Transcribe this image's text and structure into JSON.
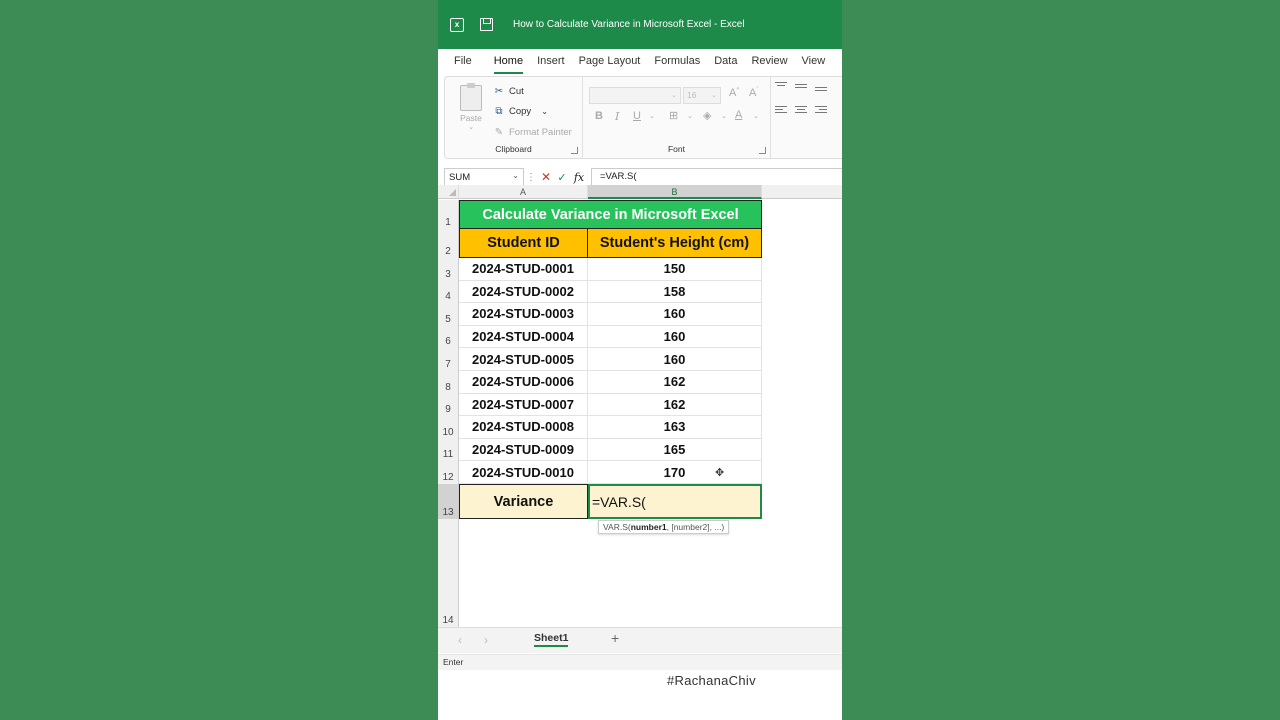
{
  "window": {
    "title": "How to Calculate Variance in Microsoft Excel  -  Excel"
  },
  "menu_tabs": [
    "File",
    "Home",
    "Insert",
    "Page Layout",
    "Formulas",
    "Data",
    "Review",
    "View"
  ],
  "ribbon": {
    "clipboard": {
      "paste": "Paste",
      "cut": "Cut",
      "copy": "Copy",
      "format_painter": "Format Painter",
      "label": "Clipboard"
    },
    "font": {
      "size": "16",
      "label": "Font"
    }
  },
  "formula_bar": {
    "name_box": "SUM",
    "formula": "=VAR.S("
  },
  "columns": [
    "A",
    "B"
  ],
  "rows": [
    "1",
    "2",
    "3",
    "4",
    "5",
    "6",
    "7",
    "8",
    "9",
    "10",
    "11",
    "12",
    "13",
    "14"
  ],
  "sheet": {
    "title": "Calculate Variance in Microsoft Excel",
    "headers": [
      "Student ID",
      "Student's Height (cm)"
    ],
    "data": [
      [
        "2024-STUD-0001",
        "150"
      ],
      [
        "2024-STUD-0002",
        "158"
      ],
      [
        "2024-STUD-0003",
        "160"
      ],
      [
        "2024-STUD-0004",
        "160"
      ],
      [
        "2024-STUD-0005",
        "160"
      ],
      [
        "2024-STUD-0006",
        "162"
      ],
      [
        "2024-STUD-0007",
        "162"
      ],
      [
        "2024-STUD-0008",
        "163"
      ],
      [
        "2024-STUD-0009",
        "165"
      ],
      [
        "2024-STUD-0010",
        "170"
      ]
    ],
    "variance_label": "Variance",
    "editing_value": "=VAR.S(",
    "tooltip": {
      "fn": "VAR.S(",
      "arg1": "number1",
      "rest": ", [number2], ...)"
    }
  },
  "sheet_tab": "Sheet1",
  "status": "Enter",
  "watermark": "#RachanaChiv",
  "colors": {
    "title_green": "#27c25c",
    "header_gold": "#ffc000",
    "excel_green": "#1e8a4a",
    "variance_fill": "#fdf3d0"
  }
}
